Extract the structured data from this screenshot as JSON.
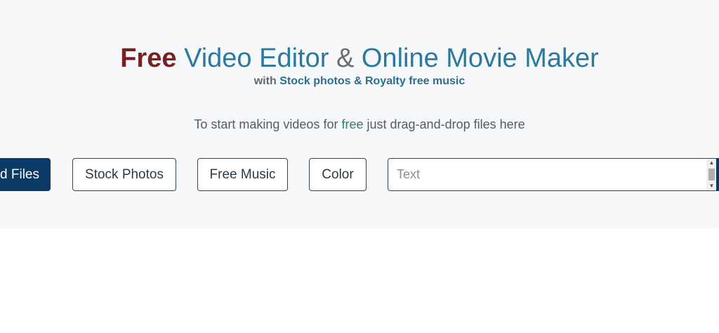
{
  "hero": {
    "title": {
      "free": "Free",
      "part1": "Video Editor",
      "amp": "&",
      "part2": "Online Movie Maker"
    },
    "subtitle": {
      "lead": "with",
      "highlight": "Stock photos & Royalty free music"
    },
    "instruction": {
      "before": "To start making videos for",
      "free": "free",
      "after": "just drag-and-drop files here"
    }
  },
  "toolbar": {
    "add_files_label": "d Files",
    "stock_photos_label": "Stock Photos",
    "free_music_label": "Free Music",
    "color_label": "Color",
    "text_placeholder": "Text",
    "text_value": ""
  },
  "icons": {
    "scroll_up": "scroll-up-arrow",
    "scroll_down": "scroll-down-arrow"
  },
  "colors": {
    "hero_background": "#f6f8fa",
    "free_word": "#7a1f22",
    "title_blue": "#2a7aa0",
    "primary_button": "#0c3a66",
    "button_border": "#234a5e"
  }
}
